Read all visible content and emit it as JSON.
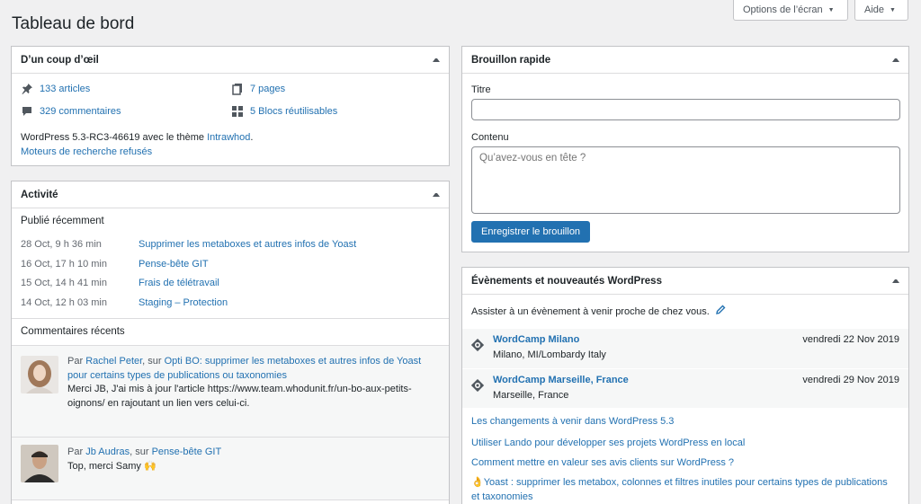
{
  "page": {
    "title": "Tableau de bord"
  },
  "screen_tabs": {
    "options": "Options de l’écran",
    "help": "Aide"
  },
  "glance": {
    "title": "D’un coup d’œil",
    "posts": "133 articles",
    "pages": "7 pages",
    "comments": "329 commentaires",
    "blocks": "5 Blocs réutilisables",
    "version_prefix": "WordPress 5.3-RC3-46619 avec le thème ",
    "theme": "Intrawhod",
    "version_suffix": ".",
    "search_engines": "Moteurs de recherche refusés"
  },
  "activity": {
    "title": "Activité",
    "recent_title": "Publié récemment",
    "recent": [
      {
        "date": "28 Oct, 9 h 36 min",
        "title": "Supprimer les metaboxes et autres infos de Yoast"
      },
      {
        "date": "16 Oct, 17 h 10 min",
        "title": "Pense-bête GIT"
      },
      {
        "date": "15 Oct, 14 h 41 min",
        "title": "Frais de télétravail"
      },
      {
        "date": "14 Oct, 12 h 03 min",
        "title": "Staging – Protection"
      }
    ],
    "comments_title": "Commentaires récents",
    "comments": [
      {
        "by": "Par ",
        "author": "Rachel Peter",
        "on": ", sur ",
        "post": "Opti BO: supprimer les metaboxes et autres infos de Yoast pour certains types de publications ou taxonomies",
        "text": "Merci JB, J'ai mis à jour l'article https://www.team.whodunit.fr/un-bo-aux-petits-oignons/ en rajoutant un lien vers celui-ci."
      },
      {
        "by": "Par ",
        "author": "Jb Audras",
        "on": ", sur ",
        "post": "Pense-bête GIT",
        "text": "Top, merci Samy 🙌"
      }
    ]
  },
  "draft": {
    "title": "Brouillon rapide",
    "title_label": "Titre",
    "title_value": "",
    "content_label": "Contenu",
    "content_placeholder": "Qu’avez-vous en tête ?",
    "save": "Enregistrer le brouillon"
  },
  "events": {
    "title": "Évènements et nouveautés WordPress",
    "intro": "Assister à un évènement à venir proche de chez vous.",
    "items": [
      {
        "name": "WordCamp Milano",
        "location": "Milano, MI/Lombardy Italy",
        "date": "vendredi 22 Nov 2019"
      },
      {
        "name": "WordCamp Marseille, France",
        "location": "Marseille, France",
        "date": "vendredi 29 Nov 2019"
      }
    ],
    "news": [
      "Les changements à venir dans WordPress 5.3",
      "Utiliser Lando pour développer ses projets WordPress en local",
      "Comment mettre en valeur ses avis clients sur WordPress ?",
      "👌Yoast : supprimer les metabox, colonnes et filtres inutiles pour certains types de publications et taxonomies"
    ]
  },
  "colors": {
    "link": "#2271b1",
    "primary_button": "#2271b1",
    "background": "#f0f0f1"
  }
}
